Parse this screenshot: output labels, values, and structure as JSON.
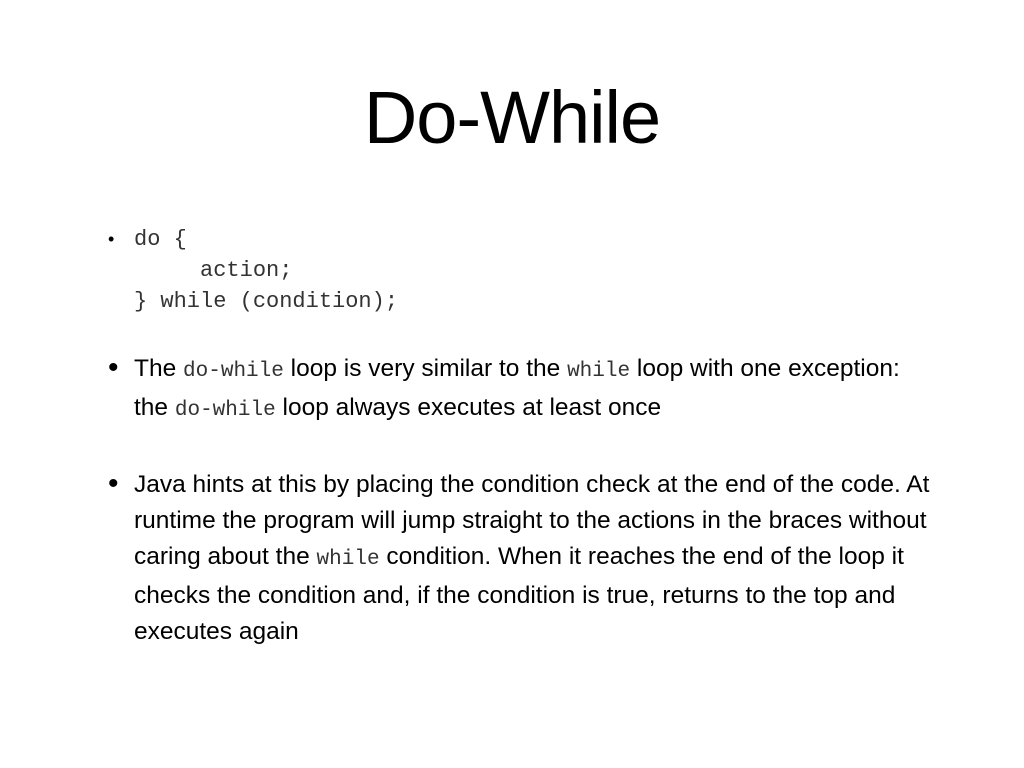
{
  "slide": {
    "title": "Do-While",
    "bullets": [
      {
        "code": "do {\n     action;\n} while (condition);"
      },
      {
        "segments": [
          "The ",
          "do-while",
          " loop is very similar to the ",
          "while",
          " loop with one exception: the ",
          "do-while",
          " loop always executes at least once"
        ]
      },
      {
        "segments": [
          "Java hints at this by placing the condition check at the end of the code. At runtime the program will jump straight to the actions in the braces without caring about the ",
          "while",
          " condition. When it reaches the end of the loop it checks the condition and, if the condition is true, returns to the top and executes again"
        ]
      }
    ]
  }
}
